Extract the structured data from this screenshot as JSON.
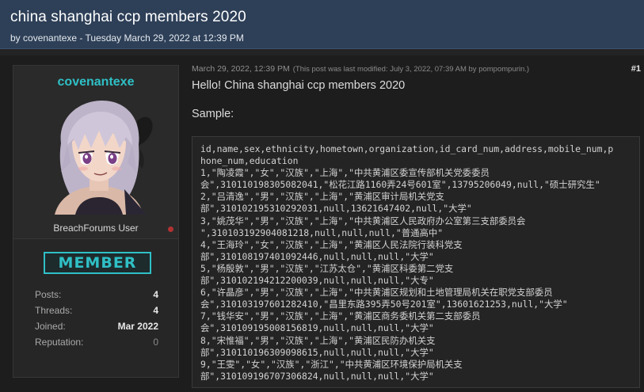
{
  "thread": {
    "title": "china shanghai ccp members 2020",
    "byline_prefix": "by ",
    "author": "covenantexe",
    "byline_suffix": " - Tuesday March 29, 2022 at 12:39 PM"
  },
  "author_card": {
    "username": "covenantexe",
    "group": "BreachForums User",
    "badge": "MEMBER",
    "stats": [
      {
        "label": "Posts:",
        "value": "4"
      },
      {
        "label": "Threads:",
        "value": "4"
      },
      {
        "label": "Joined:",
        "value": "Mar 2022"
      },
      {
        "label": "Reputation:",
        "value": "0"
      }
    ]
  },
  "post": {
    "date": "March 29, 2022, 12:39 PM",
    "edited_note": "(This post was last modified: July 3, 2022, 07:39 AM by pompompurin.)",
    "number": "#1",
    "greeting": "Hello! China shanghai ccp members 2020",
    "sample_label": "Sample:",
    "code_lines": [
      "id,name,sex,ethnicity,hometown,organization,id_card_num,address,mobile_num,p",
      "hone_num,education",
      "1,\"陶凌霞\",\"女\",\"汉族\",\"上海\",\"中共黄浦区委宣传部机关党委委员",
      "会\",310110198305082041,\"松花江路1160弄24号601室\",13795206049,null,\"硕士研究生\"",
      "2,\"吕清逸\",\"男\",\"汉族\",\"上海\",\"黄浦区审计局机关党支",
      "部\",310102195310292031,null,13621647402,null,\"大学\"",
      "3,\"姚茂华\",\"男\",\"汉族\",\"上海\",\"中共黄浦区人民政府办公室第三支部委员会",
      "\",310103192904081218,null,null,null,\"普通高中\"",
      "4,\"王海玲\",\"女\",\"汉族\",\"上海\",\"黄浦区人民法院行装科党支",
      "部\",310108197401092446,null,null,null,\"大学\"",
      "5,\"杨殷敦\",\"男\",\"汉族\",\"江苏太仓\",\"黄浦区科委第二党支",
      "部\",310102194212200039,null,null,null,\"大专\"",
      "6,\"许晶彦\",\"男\",\"汉族\",\"上海\",\"中共黄浦区规划和土地管理局机关在职党支部委员",
      "会\",310103197601282410,\"昌里东路395弄50号201室\",13601621253,null,\"大学\"",
      "7,\"钱华安\",\"男\",\"汉族\",\"上海\",\"黄浦区商务委机关第二支部委员",
      "会\",310109195008156819,null,null,null,\"大学\"",
      "8,\"宋惟福\",\"男\",\"汉族\",\"上海\",\"黄浦区民防办机关支",
      "部\",310110196309098615,null,null,null,\"大学\"",
      "9,\"王雯\",\"女\",\"汉族\",\"浙江\",\"中共黄浦区环境保护局机关支",
      "部\",310109196707306824,null,null,null,\"大学\""
    ]
  },
  "colors": {
    "header_bg": "#2e4058",
    "accent": "#2fc0c6",
    "page_bg": "#1d1d1d",
    "offline_dot": "#b13232"
  },
  "icons": {
    "avatar": "anime-girl-avatar",
    "status": "status-dot-icon"
  }
}
